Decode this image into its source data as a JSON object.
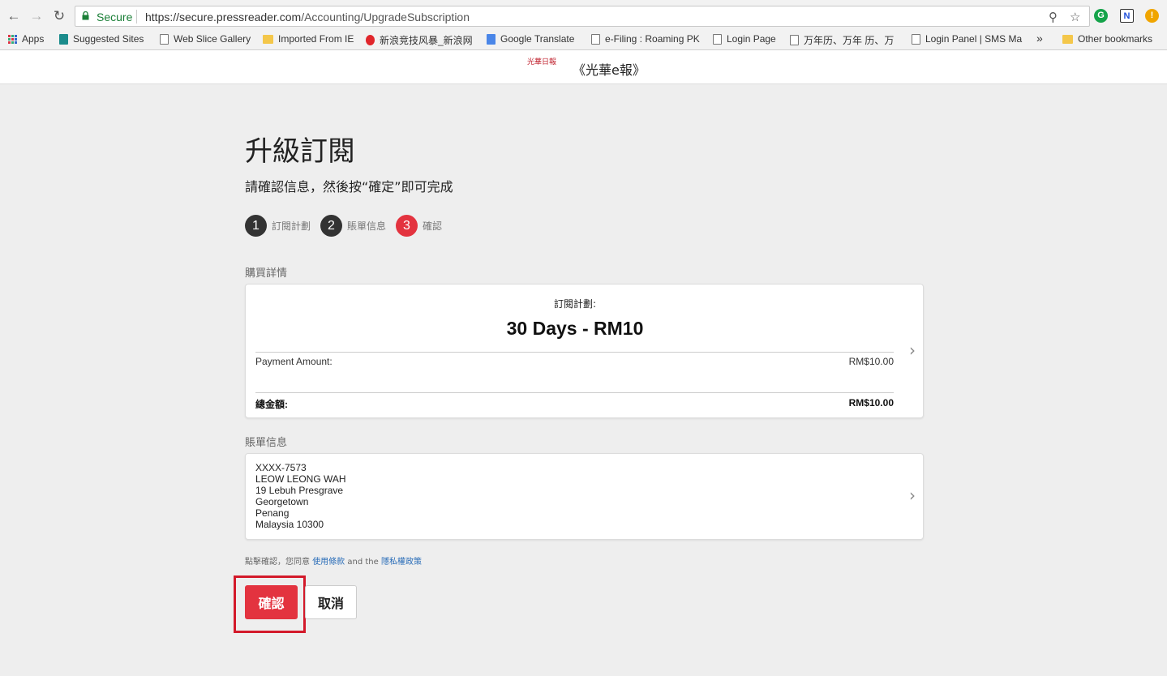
{
  "browser": {
    "secure_label": "Secure",
    "url_host": "https://secure.pressreader.com",
    "url_path": "/Accounting/UpgradeSubscription",
    "bookmarks": [
      {
        "label": "Apps"
      },
      {
        "label": "Suggested Sites"
      },
      {
        "label": "Web Slice Gallery"
      },
      {
        "label": "Imported From IE"
      },
      {
        "label": "新浪竞技风暴_新浪网"
      },
      {
        "label": "Google Translate"
      },
      {
        "label": "e-Filing : Roaming PK"
      },
      {
        "label": "Login Page"
      },
      {
        "label": "万年历、万年 历、万"
      },
      {
        "label": "Login Panel | SMS Ma"
      },
      {
        "label": "»"
      },
      {
        "label": "Other bookmarks"
      }
    ]
  },
  "header": {
    "logo_text": "光華日報",
    "publication": "《光華e報》"
  },
  "page": {
    "title": "升級訂閱",
    "subtitle": "請確認信息，然後按“確定”即可完成",
    "steps": [
      {
        "num": "1",
        "label": "訂閱計劃",
        "color": "#333333"
      },
      {
        "num": "2",
        "label": "賬單信息",
        "color": "#333333"
      },
      {
        "num": "3",
        "label": "確認",
        "color": "#e3333f"
      }
    ]
  },
  "purchase": {
    "section_label": "購買詳情",
    "plan_caption": "訂閱計劃:",
    "plan_name": "30 Days - RM10",
    "payment_label": "Payment Amount:",
    "payment_value": "RM$10.00",
    "total_label": "總金額:",
    "total_value": "RM$10.00"
  },
  "billing": {
    "section_label": "賬單信息",
    "lines": [
      "XXXX-7573",
      "LEOW LEONG WAH",
      "19 Lebuh Presgrave",
      "Georgetown",
      "Penang",
      "Malaysia 10300"
    ]
  },
  "terms": {
    "prefix": "點擊確認，您同意",
    "terms_link": "使用條款",
    "and": "and the",
    "privacy_link": "隱私權政策"
  },
  "actions": {
    "confirm_label": "確認",
    "cancel_label": "取消"
  },
  "colors": {
    "accent": "#e3333f",
    "highlight_frame": "#d3192a"
  }
}
